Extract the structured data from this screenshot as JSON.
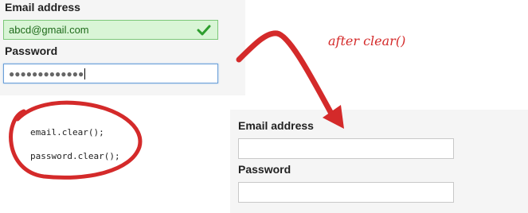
{
  "before": {
    "email_label": "Email address",
    "email_value": "abcd@gmail.com",
    "email_status_icon": "checkmark-icon",
    "password_label": "Password",
    "password_masked": "●●●●●●●●●●●●●"
  },
  "after": {
    "email_label": "Email address",
    "email_value": "",
    "password_label": "Password",
    "password_value": ""
  },
  "annotation": {
    "note": "after clear()",
    "code_lines": [
      "email.clear();",
      "password.clear();"
    ],
    "accent_color": "#d42a2a",
    "valid_bg": "#d9f5d6"
  }
}
